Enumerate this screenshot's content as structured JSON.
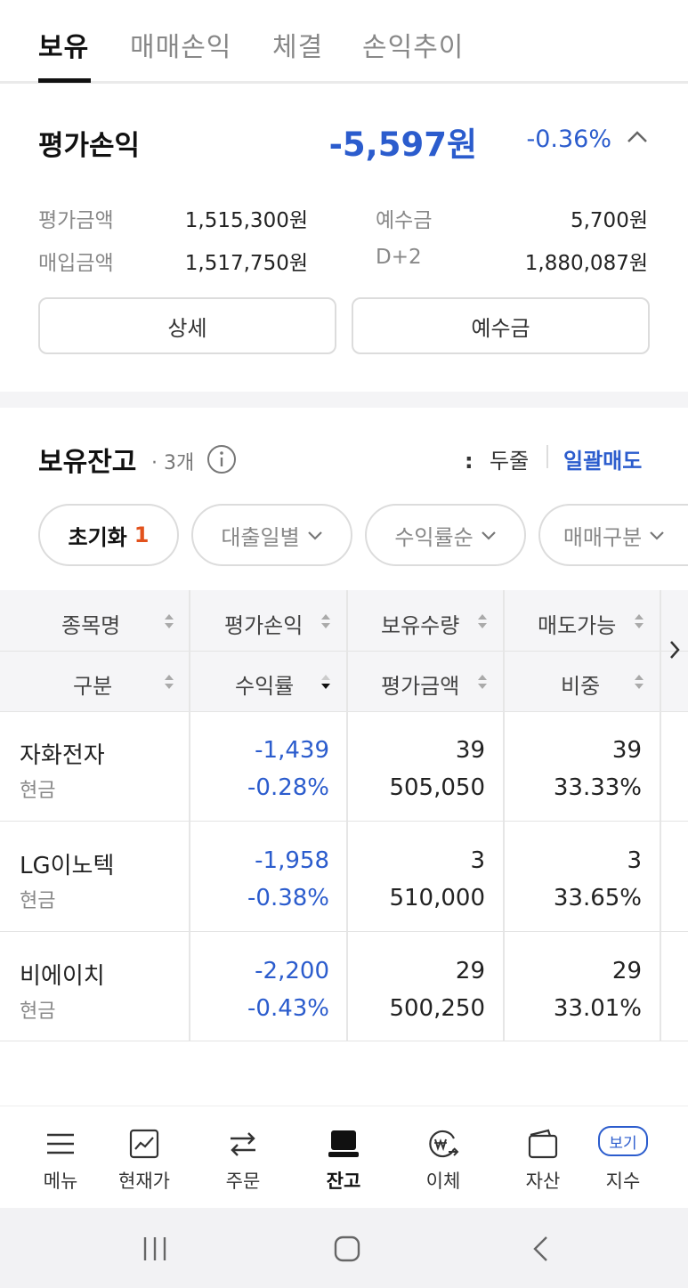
{
  "tabs": [
    "보유",
    "매매손익",
    "체결",
    "손익추이"
  ],
  "summary": {
    "title": "평가손익",
    "amount": "-5,597원",
    "rate": "-0.36%",
    "eval_label": "평가금액",
    "eval_value": "1,515,300원",
    "deposit_label": "예수금",
    "deposit_value": "5,700원",
    "buy_label": "매입금액",
    "buy_value": "1,517,750원",
    "d2_label": "D+2",
    "d2_value": "1,880,087원",
    "detail_button": "상세",
    "deposit_button": "예수금"
  },
  "holdings": {
    "title": "보유잔고",
    "count": "· 3개",
    "two_line": "두줄",
    "bulk_sell": "일괄매도"
  },
  "chips": {
    "reset": "초기화",
    "reset_count": "1",
    "loan_date": "대출일별",
    "profit_order": "수익률순",
    "trade_type": "매매구분"
  },
  "table": {
    "headers_row1": [
      "종목명",
      "평가손익",
      "보유수량",
      "매도가능"
    ],
    "headers_row2": [
      "구분",
      "수익률",
      "평가금액",
      "비중"
    ],
    "rows": [
      {
        "name": "자화전자",
        "type": "현금",
        "pl": "-1,439",
        "rate": "-0.28%",
        "qty": "39",
        "eval": "505,050",
        "sellable": "39",
        "weight": "33.33%"
      },
      {
        "name": "LG이노텍",
        "type": "현금",
        "pl": "-1,958",
        "rate": "-0.38%",
        "qty": "3",
        "eval": "510,000",
        "sellable": "3",
        "weight": "33.65%"
      },
      {
        "name": "비에이치",
        "type": "현금",
        "pl": "-2,200",
        "rate": "-0.43%",
        "qty": "29",
        "eval": "500,250",
        "sellable": "29",
        "weight": "33.01%"
      }
    ]
  },
  "nav": {
    "menu": "메뉴",
    "price": "현재가",
    "order": "주문",
    "balance": "잔고",
    "transfer": "이체",
    "assets": "자산",
    "index_badge": "보기",
    "index": "지수"
  },
  "colors": {
    "accent_blue": "#2b5ccd",
    "accent_orange": "#e2521d"
  }
}
